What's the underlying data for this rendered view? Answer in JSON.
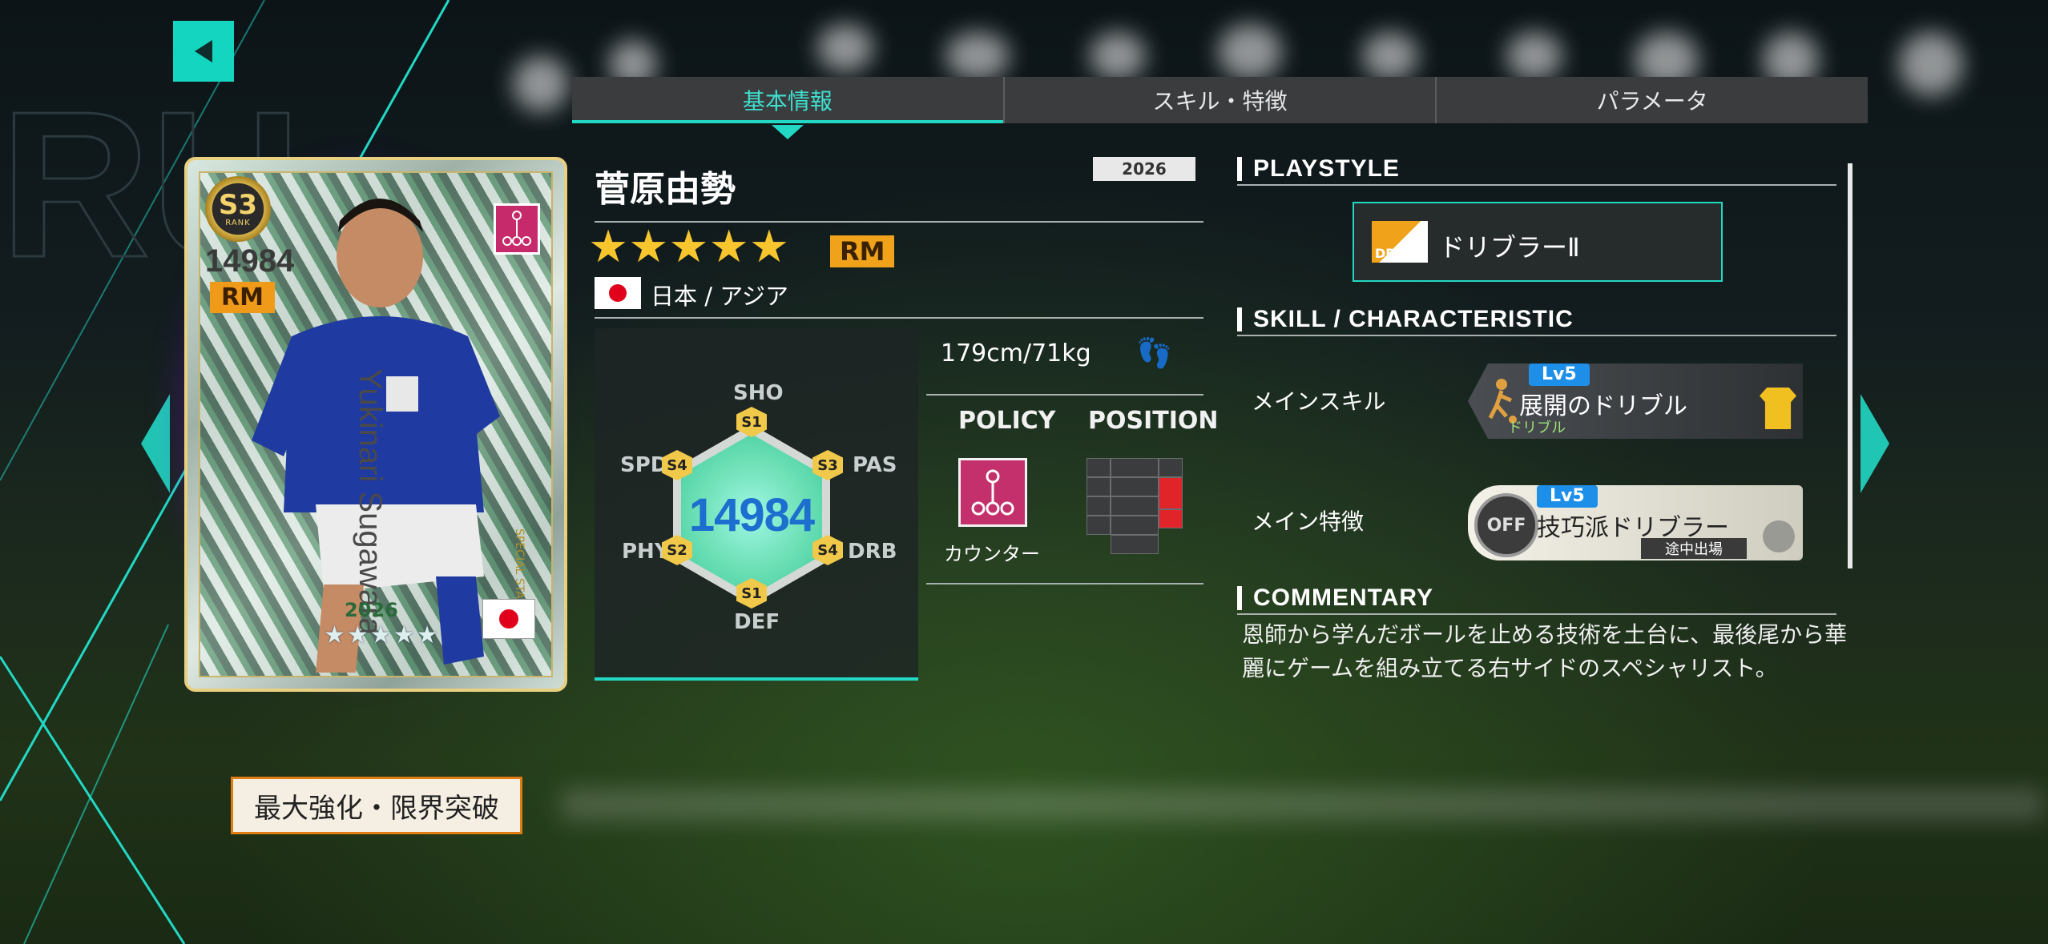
{
  "tabs": [
    {
      "label": "基本情報",
      "active": true
    },
    {
      "label": "スキル・特徴",
      "active": false
    },
    {
      "label": "パラメータ",
      "active": false
    }
  ],
  "card": {
    "rank": "S3",
    "rank_text": "RANK",
    "rating": "14984",
    "position": "RM",
    "name_vertical": "Yukinari Sugawara",
    "special_text": "SPECIAL STAR",
    "year": "2026",
    "stars": "★★★★★"
  },
  "player": {
    "name": "菅原由勢",
    "year": "2026",
    "stars": "★★★★★",
    "position": "RM",
    "nation": "日本 / アジア",
    "height_weight": "179cm/71kg",
    "total": "14984"
  },
  "stats": [
    {
      "key": "SHO",
      "rank": "S1"
    },
    {
      "key": "PAS",
      "rank": "S3"
    },
    {
      "key": "DRB",
      "rank": "S4"
    },
    {
      "key": "DEF",
      "rank": "S1"
    },
    {
      "key": "PHY",
      "rank": "S2"
    },
    {
      "key": "SPD",
      "rank": "S4"
    }
  ],
  "stat_rank_text": {
    "sho": "S1",
    "pas": "S3",
    "drb": "S4",
    "def": "S1",
    "phy": "S2",
    "spd": "S4"
  },
  "policy": {
    "title": "POLICY",
    "label": "カウンター"
  },
  "position_section": {
    "title": "POSITION"
  },
  "sections": {
    "playstyle": "PLAYSTYLE",
    "skill": "SKILL / CHARACTERISTIC",
    "commentary": "COMMENTARY"
  },
  "playstyle": {
    "icon_text": "DRB",
    "label": "ドリブラーⅡ"
  },
  "main_skill": {
    "row_label": "メインスキル",
    "level": "Lv5",
    "name": "展開のドリブル",
    "sub": "ドリブル"
  },
  "main_char": {
    "row_label": "メイン特徴",
    "level": "Lv5",
    "name": "技巧派ドリブラー",
    "sub": "途中出場",
    "off": "OFF"
  },
  "commentary": "恩師から学んだボールを止める技術を土台に、最後尾から華麗にゲームを組み立てる右サイドのスペシャリスト。",
  "buttons": {
    "max": "最大強化・限界突破"
  },
  "colors": {
    "accent": "#22d8c4",
    "gold": "#f1c94a",
    "orange": "#f0a21a"
  }
}
